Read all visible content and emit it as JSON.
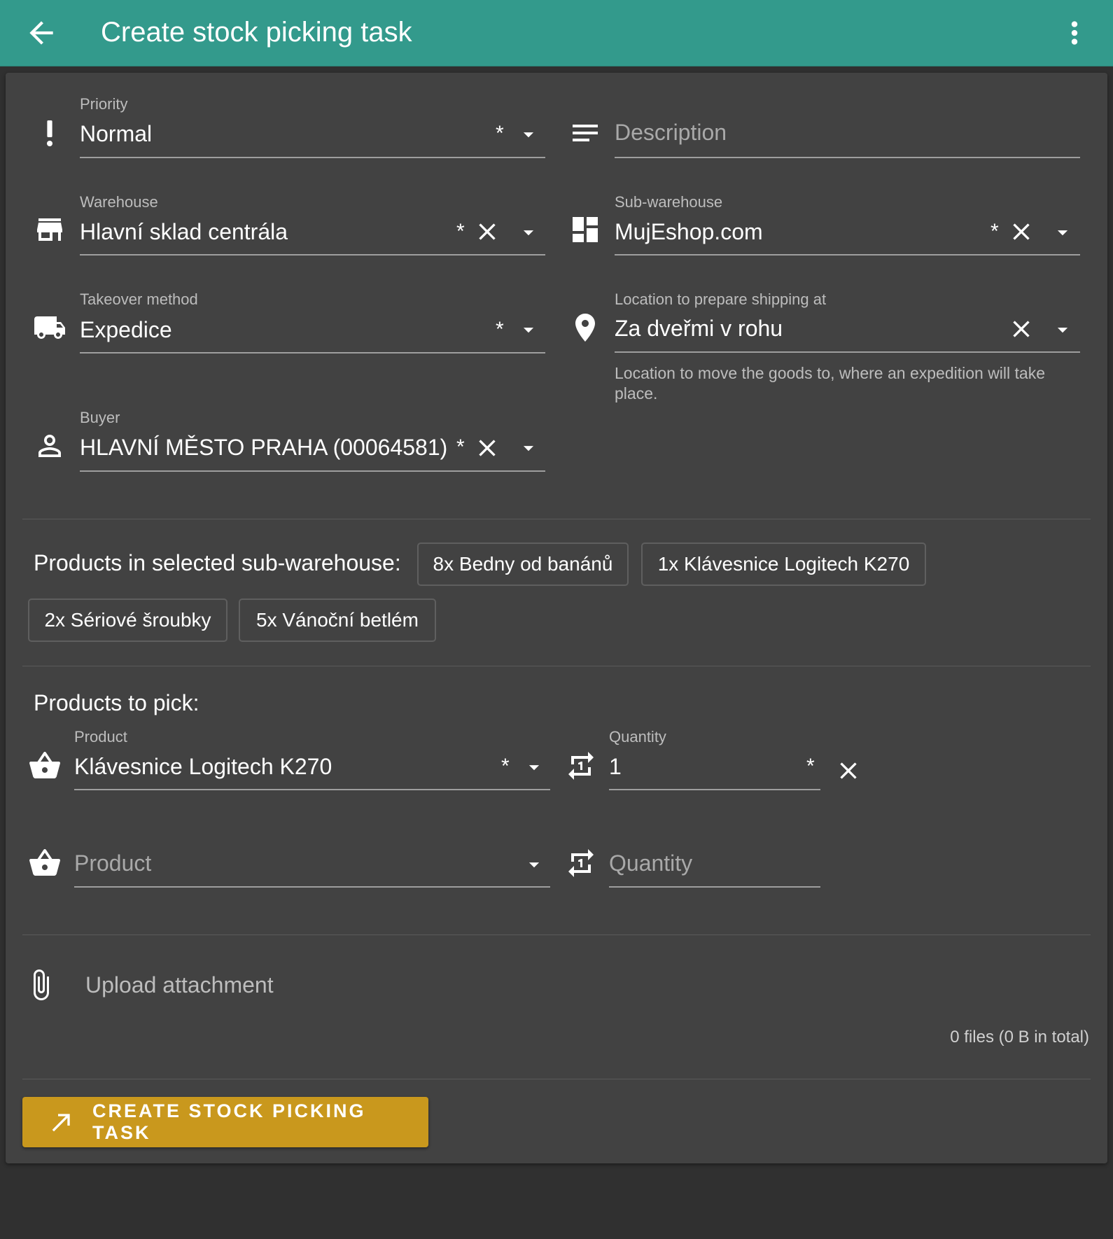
{
  "appbar": {
    "title": "Create stock picking task",
    "back_icon": "arrow-left-icon",
    "menu_icon": "more-vert-icon",
    "background": "#339a8c"
  },
  "form": {
    "priority": {
      "label": "Priority",
      "value": "Normal",
      "required": "*",
      "icon": "exclamation-icon"
    },
    "description": {
      "placeholder": "Description",
      "icon": "notes-icon"
    },
    "warehouse": {
      "label": "Warehouse",
      "value": "Hlavní sklad centrála",
      "required": "*",
      "icon": "store-icon"
    },
    "sub_warehouse": {
      "label": "Sub-warehouse",
      "value": "MujEshop.com",
      "required": "*",
      "icon": "dashboard-icon"
    },
    "takeover_method": {
      "label": "Takeover method",
      "value": "Expedice",
      "required": "*",
      "icon": "truck-icon"
    },
    "shipping_location": {
      "label": "Location to prepare shipping at",
      "value": "Za dveřmi v rohu",
      "hint": "Location to move the goods to, where an expedition will take place.",
      "icon": "location-pin-icon"
    },
    "buyer": {
      "label": "Buyer",
      "value": "HLAVNÍ MĚSTO PRAHA (00064581)",
      "required": "*",
      "icon": "person-icon"
    }
  },
  "subwarehouse_products": {
    "title": "Products in selected sub-warehouse:",
    "chips": [
      "8x Bedny od banánů",
      "1x Klávesnice Logitech K270",
      "2x Sériové šroubky",
      "5x Vánoční betlém"
    ]
  },
  "products_to_pick": {
    "title": "Products to pick:",
    "rows": [
      {
        "product_label": "Product",
        "product_value": "Klávesnice Logitech K270",
        "quantity_label": "Quantity",
        "quantity_value": "1",
        "required": "*"
      },
      {
        "product_placeholder": "Product",
        "quantity_placeholder": "Quantity"
      }
    ],
    "product_icon": "basket-icon",
    "quantity_icon": "repeat-one-icon"
  },
  "attachments": {
    "upload_label": "Upload attachment",
    "icon": "paperclip-icon",
    "summary": "0 files (0 B in total)"
  },
  "submit": {
    "label": "CREATE STOCK PICKING TASK",
    "icon": "arrow-top-right-icon",
    "color": "#c9981d"
  },
  "colors": {
    "background": "#303030",
    "card": "#424242"
  }
}
